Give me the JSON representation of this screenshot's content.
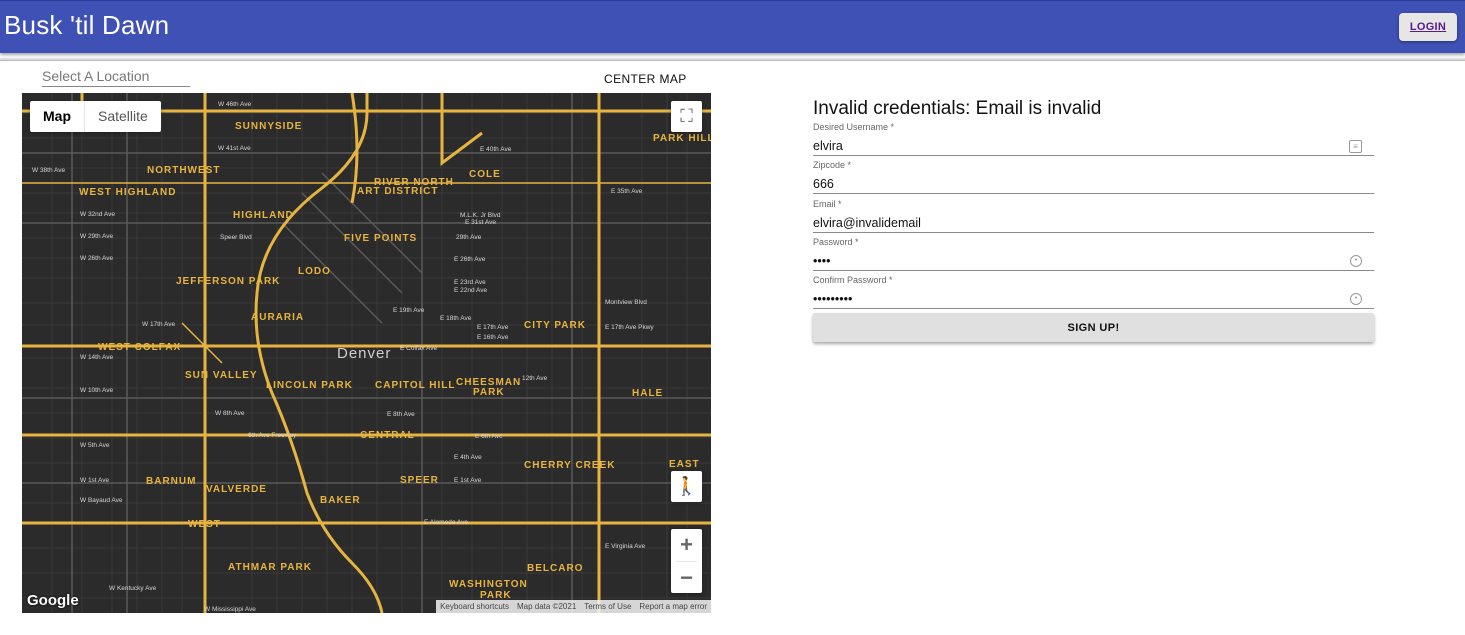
{
  "app": {
    "title": "Busk 'til Dawn",
    "login_label": "LOGIN"
  },
  "toolbar": {
    "location_placeholder": "Select A Location",
    "center_map_label": "CENTER MAP"
  },
  "map": {
    "type_options": [
      "Map",
      "Satellite"
    ],
    "selected_type": "Map",
    "neighborhoods": [
      "SUNNYSIDE",
      "NORTHWEST",
      "WEST HIGHLAND",
      "HIGHLAND",
      "RIVER NORTH",
      "ART DISTRICT",
      "COLE",
      "FIVE POINTS",
      "LODO",
      "JEFFERSON PARK",
      "AURARIA",
      "CITY PARK",
      "WEST COLFAX",
      "SUN VALLEY",
      "LINCOLN PARK",
      "CAPITOL HILL",
      "CHEESMAN",
      "PARK",
      "HALE",
      "CENTRAL",
      "BARNUM",
      "VALVERDE",
      "SPEER",
      "CHERRY CREEK",
      "EAST",
      "WEST",
      "BAKER",
      "ATHMAR PARK",
      "BELCARO",
      "WASHINGTON",
      "PARK",
      "PARK HILL"
    ],
    "city_label": "Denver",
    "street_labels": [
      "W 46th Ave",
      "W 41st Ave",
      "W 38th Ave",
      "W 32nd Ave",
      "W 29th Ave",
      "W 26th Ave",
      "W 17th Ave",
      "W 14th Ave",
      "W 10th Ave",
      "W 8th Ave",
      "W 5th Ave",
      "W 1st Ave",
      "W Bayaud Ave",
      "E 40th Ave",
      "E 35th Ave",
      "M.L.K. Jr Blvd",
      "E 31st Ave",
      "29th Ave",
      "E 26th Ave",
      "E 23rd Ave",
      "E 22nd Ave",
      "E 19th Ave",
      "E 18th Ave",
      "E 17th Ave",
      "E 16th Ave",
      "E Colfax Ave",
      "12th Ave",
      "E 8th Ave",
      "E 6th Ave",
      "E 4th Ave",
      "E 1st Ave",
      "E Alameda Ave",
      "6th Ave Freeway",
      "Speer Blvd",
      "Montview Blvd",
      "E 17th Ave Pkwy",
      "W Mississippi Ave",
      "W Kentucky Ave",
      "E Virginia Ave"
    ],
    "controls": {
      "zoom_in": "+",
      "zoom_out": "−",
      "fullscreen": "⛶"
    },
    "google_logo": "Google",
    "attribution": [
      "Keyboard shortcuts",
      "Map data ©2021",
      "Terms of Use",
      "Report a map error"
    ]
  },
  "form": {
    "error_message": "Invalid credentials: Email is invalid",
    "fields": [
      {
        "label": "Desired Username *",
        "value": "elvira"
      },
      {
        "label": "Zipcode *",
        "value": "666"
      },
      {
        "label": "Email *",
        "value": "elvira@invalidemail"
      },
      {
        "label": "Password *",
        "value": "••••"
      },
      {
        "label": "Confirm Password *",
        "value": "•••••••••"
      }
    ],
    "submit_label": "SIGN UP!"
  },
  "colors": {
    "appbar": "#3f51b5",
    "map_bg": "#2b2b2b",
    "map_road": "#e8b440"
  }
}
